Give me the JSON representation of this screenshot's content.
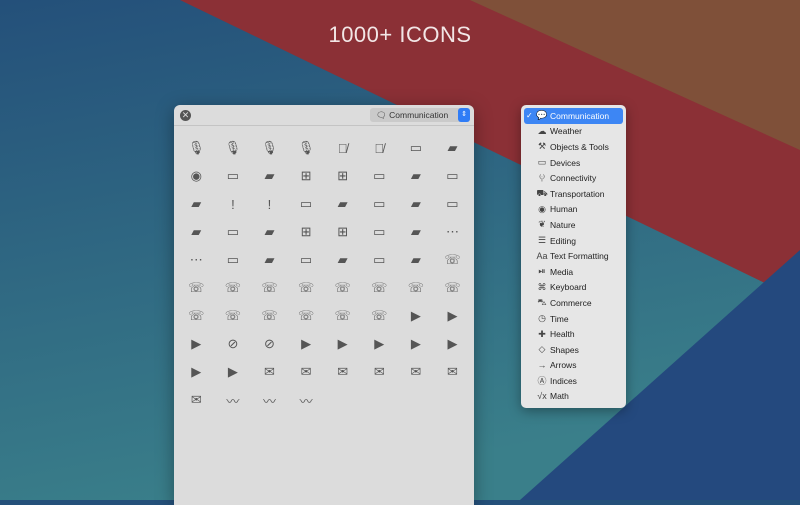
{
  "headline": "1000+ ICONS",
  "window": {
    "category_selected": "Communication",
    "close_icon": "close-icon"
  },
  "icons": [
    "mic",
    "mic-fill",
    "mic-circle",
    "mic-circle-fill",
    "mic-slash",
    "mic-slash-fill",
    "bubble-left",
    "bubble-left-fill",
    "record-circle",
    "bubble-arrow-up",
    "bubble-arrow-up-fill",
    "bubble-plus",
    "bubble-plus-fill",
    "bubble-square",
    "bubble-square-fill",
    "bubble-square-outline",
    "bubble-square-fill2",
    "exclamation-bubble",
    "exclamation-bubble-fill",
    "quote-bubble",
    "quote-bubble-fill",
    "t-bubble",
    "t-bubble-fill",
    "text-bubble",
    "text-bubble-fill",
    "captions-bubble",
    "captions-bubble-fill",
    "plus-bubble",
    "plus-bubble-fill",
    "rectangle-bubble",
    "rectangle-bubble-fill",
    "ellipsis-bubble",
    "ellipsis-bubble-fill",
    "bubble-middle",
    "bubble-middle-fill",
    "tv-bubble",
    "tv-bubble-fill",
    "bubbles",
    "bubbles-fill",
    "phone",
    "phone-fill",
    "phone-circle",
    "phone-arrow-up",
    "phone-arrow-up-fill",
    "phone-arrow-down",
    "phone-arrow-down-fill",
    "phone-arrow-right",
    "phone-arrow-right-fill",
    "phone-down",
    "phone-down-fill",
    "phone-down-circle",
    "teletype",
    "teletype-circle",
    "keypad-phone",
    "video",
    "video-fill",
    "video-circle",
    "video-slash",
    "video-slash-fill",
    "video-badge-plus",
    "arrow-up-right-video",
    "arrow-up-right-video-fill",
    "arrow-down-left-video",
    "arrow-down-left-video-fill",
    "questionmark-video",
    "questionmark-video-fill",
    "envelope",
    "envelope-fill",
    "envelope-circle",
    "envelope-open",
    "envelope-open-fill",
    "envelope-badge",
    "envelope-badge-fill",
    "waveform",
    "waveform-circle",
    "waveform-circle-fill"
  ],
  "menu": {
    "items": [
      {
        "label": "Communication",
        "icon": "bubble-icon",
        "glyph": "💬",
        "selected": true
      },
      {
        "label": "Weather",
        "icon": "cloud-icon",
        "glyph": "☁"
      },
      {
        "label": "Objects & Tools",
        "icon": "hammer-icon",
        "glyph": "⚒"
      },
      {
        "label": "Devices",
        "icon": "display-icon",
        "glyph": "▭"
      },
      {
        "label": "Connectivity",
        "icon": "antenna-icon",
        "glyph": "⁽ᵢ⁾"
      },
      {
        "label": "Transportation",
        "icon": "car-icon",
        "glyph": "⛟"
      },
      {
        "label": "Human",
        "icon": "person-circle-icon",
        "glyph": "◉"
      },
      {
        "label": "Nature",
        "icon": "leaf-icon",
        "glyph": "❦"
      },
      {
        "label": "Editing",
        "icon": "sliders-icon",
        "glyph": "☰"
      },
      {
        "label": "Text Formatting",
        "icon": "textformat-icon",
        "glyph": "Aa"
      },
      {
        "label": "Media",
        "icon": "play-pause-icon",
        "glyph": "⏯"
      },
      {
        "label": "Keyboard",
        "icon": "command-icon",
        "glyph": "⌘"
      },
      {
        "label": "Commerce",
        "icon": "cart-icon",
        "glyph": "⛍"
      },
      {
        "label": "Time",
        "icon": "timer-icon",
        "glyph": "◷"
      },
      {
        "label": "Health",
        "icon": "cross-icon",
        "glyph": "✚"
      },
      {
        "label": "Shapes",
        "icon": "diamond-icon",
        "glyph": "◇"
      },
      {
        "label": "Arrows",
        "icon": "arrow-right-icon",
        "glyph": "→"
      },
      {
        "label": "Indices",
        "icon": "a-circle-icon",
        "glyph": "Ⓐ"
      },
      {
        "label": "Math",
        "icon": "sqrt-icon",
        "glyph": "√x"
      }
    ]
  },
  "colors": {
    "accent": "#3d86f4",
    "red_band": "#8b3036",
    "brown_band": "#7f5039",
    "blue_bg": "#24507a"
  }
}
